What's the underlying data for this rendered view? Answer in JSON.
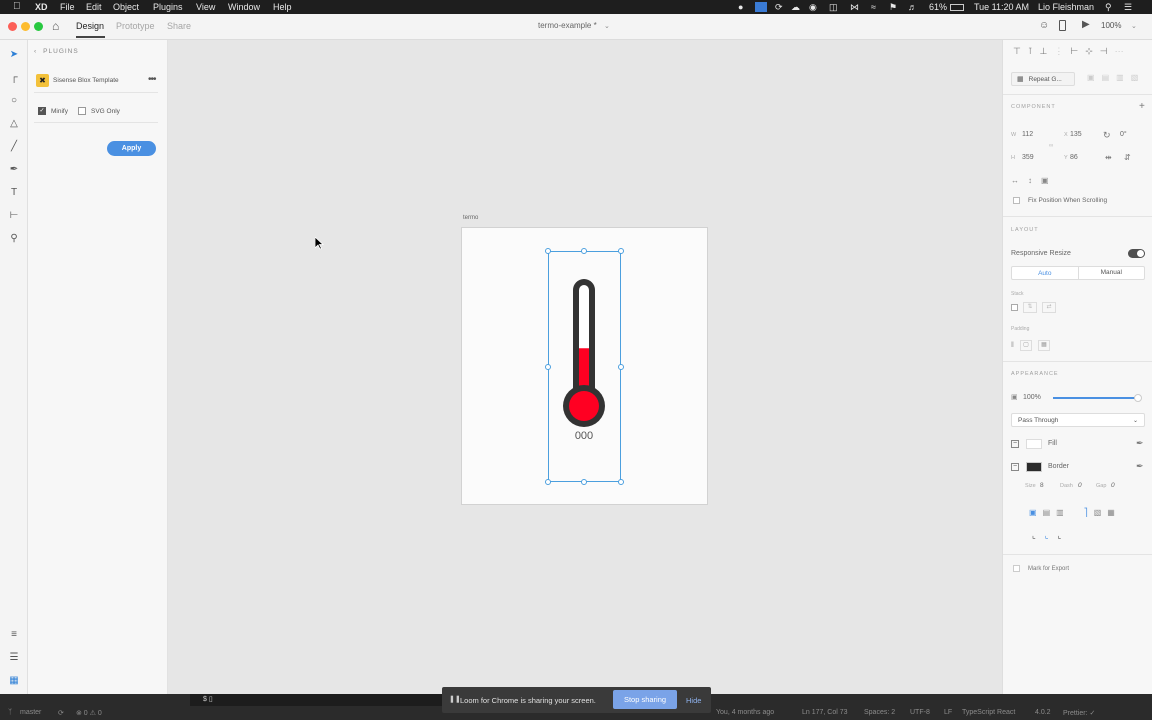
{
  "menubar": {
    "app": "XD",
    "items": [
      "File",
      "Edit",
      "Object",
      "Plugins",
      "View",
      "Window",
      "Help"
    ],
    "battery": "61%",
    "clock": "Tue 11:20 AM",
    "user": "Lio Fleishman"
  },
  "titlebar": {
    "tabs": [
      "Design",
      "Prototype",
      "Share"
    ],
    "document": "termo-example *",
    "zoom": "100%"
  },
  "plugins": {
    "back_label": "PLUGINS",
    "plugin_name": "Sisense Blox Template",
    "options": [
      {
        "label": "Minify",
        "checked": true
      },
      {
        "label": "SVG Only",
        "checked": false
      }
    ],
    "apply_label": "Apply"
  },
  "canvas": {
    "artboard_label": "termo",
    "readout": "000",
    "fill_level": 0.45,
    "mercury_color": "#ff0022",
    "frame_color": "#333333"
  },
  "inspector": {
    "repeat_grid": "Repeat G...",
    "component_header": "COMPONENT",
    "w_label": "W",
    "w_value": "112",
    "x_label": "X",
    "x_value": "135",
    "h_label": "H",
    "h_value": "359",
    "y_label": "Y",
    "y_value": "86",
    "rotation": "0°",
    "fix_position": "Fix Position When Scrolling",
    "layout_header": "LAYOUT",
    "responsive_resize": "Responsive Resize",
    "auto_label": "Auto",
    "manual_label": "Manual",
    "stack_label": "Stack",
    "padding_label": "Padding",
    "appearance_header": "APPEARANCE",
    "opacity": "100%",
    "blend_mode": "Pass Through",
    "fill_label": "Fill",
    "border_label": "Border",
    "size_label": "Size",
    "size_value": "8",
    "dash_label": "Dash",
    "dash_value": "0",
    "gap_label": "Gap",
    "gap_value": "0",
    "mark_export": "Mark for Export"
  },
  "status": {
    "branch": "master",
    "problems": "⊗ 0 ⚠ 0",
    "terminal": "$ ▯",
    "git_info": "You, 4 months ago",
    "position": "Ln 177, Col 73",
    "spaces": "Spaces: 2",
    "encoding": "UTF-8",
    "eol": "LF",
    "language": "TypeScript React",
    "version": "4.0.2",
    "prettier": "Prettier: ✓"
  },
  "sharebar": {
    "message": "Loom for Chrome is sharing your screen.",
    "stop_label": "Stop sharing",
    "hide_label": "Hide"
  },
  "colors": {
    "accent": "#4a90e2",
    "selection": "#4b9fde"
  }
}
